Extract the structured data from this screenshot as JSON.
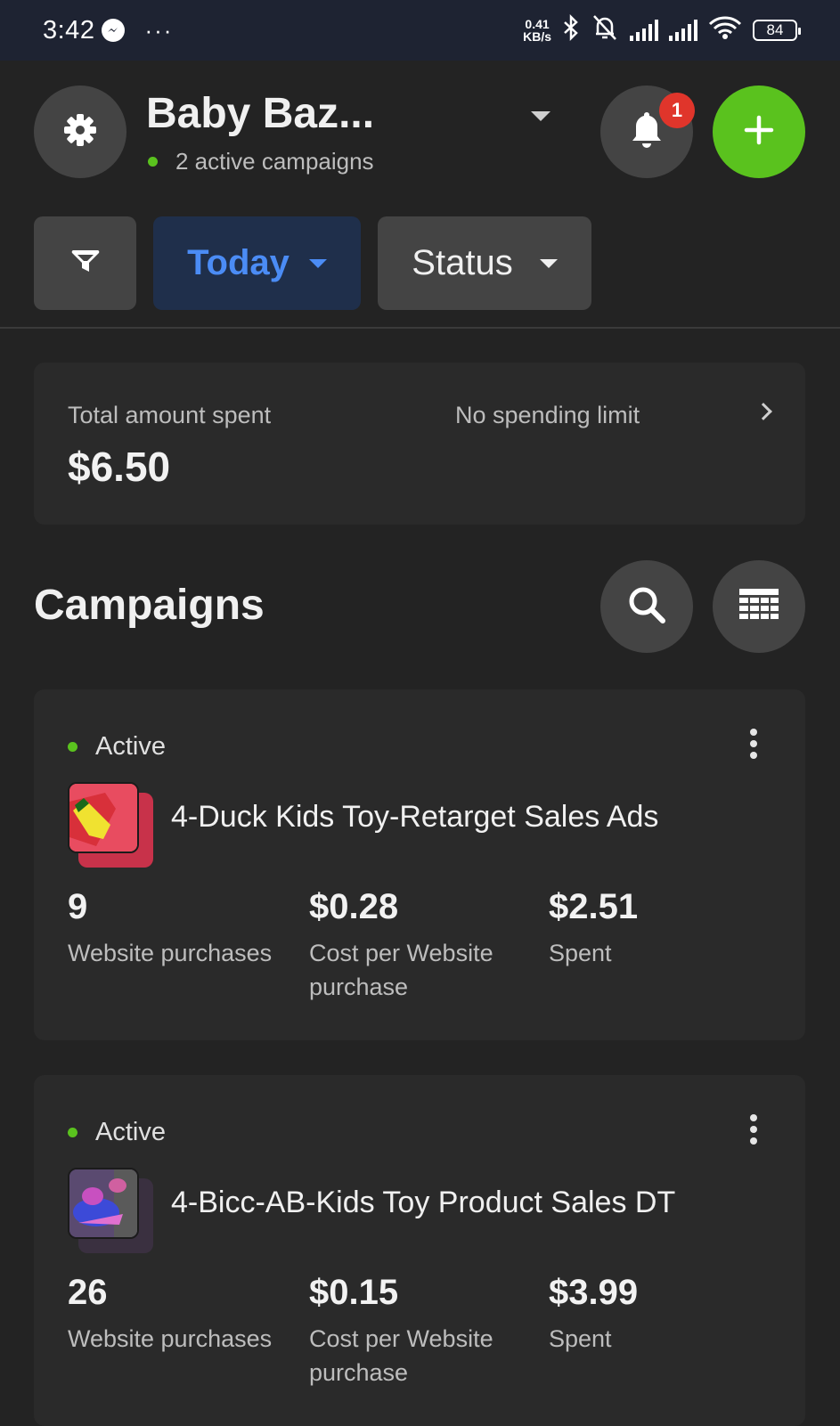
{
  "status_bar": {
    "time": "3:42",
    "more": "···",
    "network_speed_value": "0.41",
    "network_speed_unit": "KB/s",
    "battery": "84"
  },
  "header": {
    "account_name": "Baby Baz...",
    "active_campaigns": "2 active campaigns",
    "notification_count": "1"
  },
  "filters": {
    "date_label": "Today",
    "status_label": "Status"
  },
  "summary": {
    "total_label": "Total amount spent",
    "total_value": "$6.50",
    "limit_label": "No spending limit"
  },
  "campaigns": {
    "title": "Campaigns",
    "items": [
      {
        "status": "Active",
        "name": "4-Duck Kids Toy-Retarget Sales Ads",
        "purchases": "9",
        "purchases_label": "Website purchases",
        "cost": "$0.28",
        "cost_label": "Cost per Website purchase",
        "spent": "$2.51",
        "spent_label": "Spent"
      },
      {
        "status": "Active",
        "name": "4-Bicc-AB-Kids Toy Product Sales DT",
        "purchases": "26",
        "purchases_label": "Website purchases",
        "cost": "$0.15",
        "cost_label": "Cost per Website purchase",
        "spent": "$3.99",
        "spent_label": "Spent"
      }
    ]
  },
  "colors": {
    "accent_green": "#5ac21e",
    "accent_blue": "#4b8cf5",
    "badge_red": "#e0352b",
    "background": "#232323",
    "card": "#2a2a2a"
  },
  "icons": [
    "messenger-icon",
    "bluetooth-icon",
    "bell-muted-icon",
    "signal-icon",
    "wifi-icon",
    "battery-icon",
    "gear-icon",
    "dropdown-caret-icon",
    "bell-icon",
    "plus-icon",
    "filter-icon",
    "chevron-right-icon",
    "search-icon",
    "table-icon",
    "kebab-menu-icon"
  ]
}
